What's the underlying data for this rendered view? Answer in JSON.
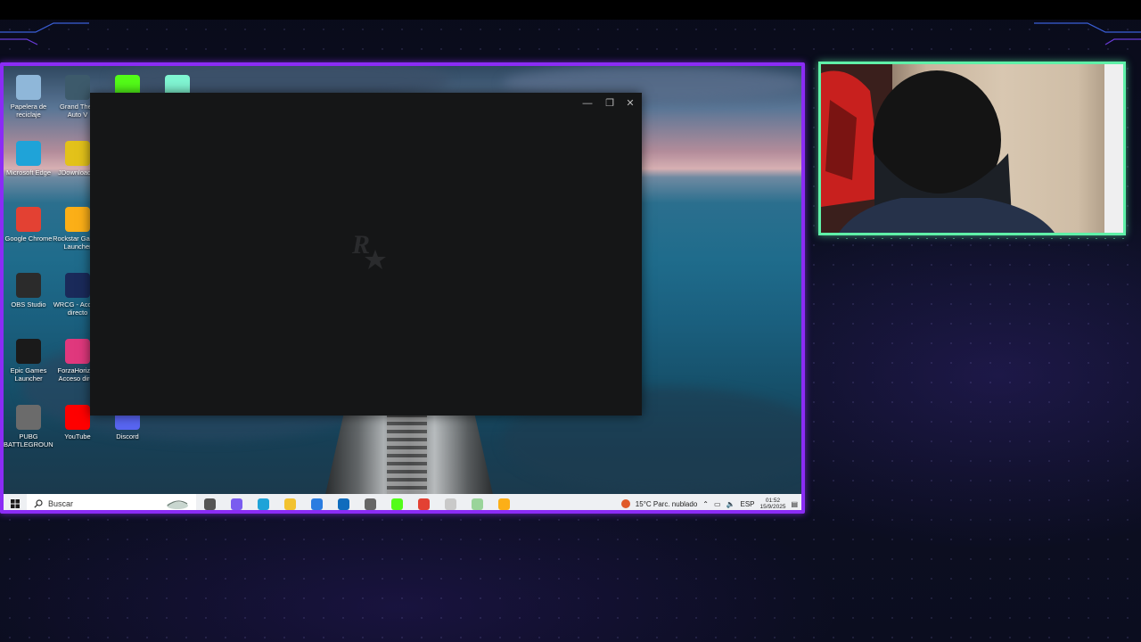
{
  "desktop_icons": [
    {
      "label": "Papelera de reciclaje",
      "icon": "recycle-bin-icon",
      "color": "#8fb7d9"
    },
    {
      "label": "Grand Theft Auto V",
      "icon": "gta-v-icon",
      "color": "#3d5a6b"
    },
    {
      "label": "",
      "icon": "kick-icon",
      "color": "#53fc18"
    },
    {
      "label": "",
      "icon": "streamlabs-icon",
      "color": "#80f5d2"
    },
    {
      "label": "Microsoft Edge",
      "icon": "edge-icon",
      "color": "#1fa3d8"
    },
    {
      "label": "JDownloader",
      "icon": "jdownloader-icon",
      "color": "#e3c21a"
    },
    {
      "label": "Google Chrome",
      "icon": "chrome-icon",
      "color": "#e34133"
    },
    {
      "label": "Rockstar Games Launcher",
      "icon": "rockstar-icon",
      "color": "#fcaf17"
    },
    {
      "label": "OBS Studio",
      "icon": "obs-icon",
      "color": "#2b2b2b"
    },
    {
      "label": "WRCG - Acceso directo",
      "icon": "wrcg-icon",
      "color": "#1a2a5a"
    },
    {
      "label": "Epic Games Launcher",
      "icon": "epic-games-icon",
      "color": "#1a1a1a"
    },
    {
      "label": "ForzaHorizon Acceso direc",
      "icon": "forza-icon",
      "color": "#e0387d"
    },
    {
      "label": "PUBG BATTLEGROUN...",
      "icon": "pubg-icon",
      "color": "#6b6b6b"
    },
    {
      "label": "YouTube",
      "icon": "youtube-icon",
      "color": "#ff0000"
    },
    {
      "label": "Discord",
      "icon": "discord-icon",
      "color": "#5865f2"
    }
  ],
  "launcher": {
    "minimize": "—",
    "maximize": "❐",
    "close": "✕",
    "logo_icon": "rockstar-logo-icon"
  },
  "taskbar": {
    "search_placeholder": "Buscar",
    "apps": [
      {
        "icon": "task-view-icon",
        "color": "#555555"
      },
      {
        "icon": "copilot-icon",
        "color": "#7a5cf0"
      },
      {
        "icon": "edge-icon",
        "color": "#1fa3d8"
      },
      {
        "icon": "file-explorer-icon",
        "color": "#f2c230"
      },
      {
        "icon": "store-icon",
        "color": "#2a7de1"
      },
      {
        "icon": "outlook-icon",
        "color": "#0f6cbd"
      },
      {
        "icon": "settings-icon",
        "color": "#666666"
      },
      {
        "icon": "kick-icon",
        "color": "#53fc18"
      },
      {
        "icon": "chrome-icon",
        "color": "#e34133"
      },
      {
        "icon": "app-icon",
        "color": "#c9c9c9"
      },
      {
        "icon": "app-icon-2",
        "color": "#9ad49a"
      },
      {
        "icon": "rockstar-icon",
        "color": "#fcaf17"
      }
    ],
    "weather": "15°C  Parc. nublado",
    "language": "ESP",
    "time": "01:52",
    "date": "15/9/2025"
  }
}
